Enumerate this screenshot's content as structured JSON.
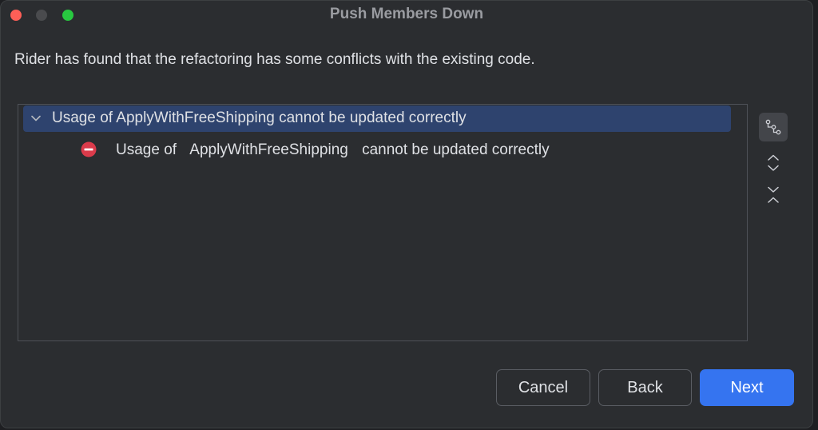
{
  "window": {
    "title": "Push Members Down"
  },
  "message": "Rider has found that the refactoring has some conflicts with the existing code.",
  "tree": {
    "parent": {
      "label": "Usage of ApplyWithFreeShipping cannot be updated correctly",
      "expanded": true,
      "icon": "chevron-down-icon"
    },
    "children": [
      {
        "icon": "error-icon",
        "prefix": "Usage of",
        "member": "ApplyWithFreeShipping",
        "suffix": "cannot be updated correctly"
      }
    ]
  },
  "side_tools": [
    {
      "icon": "group-by-icon",
      "active": true
    },
    {
      "icon": "expand-all-icon",
      "active": false
    },
    {
      "icon": "collapse-all-icon",
      "active": false
    }
  ],
  "buttons": {
    "cancel": "Cancel",
    "back": "Back",
    "next": "Next"
  },
  "colors": {
    "accent": "#3574f0",
    "selection": "#2e436e",
    "error": "#db3b4b"
  }
}
